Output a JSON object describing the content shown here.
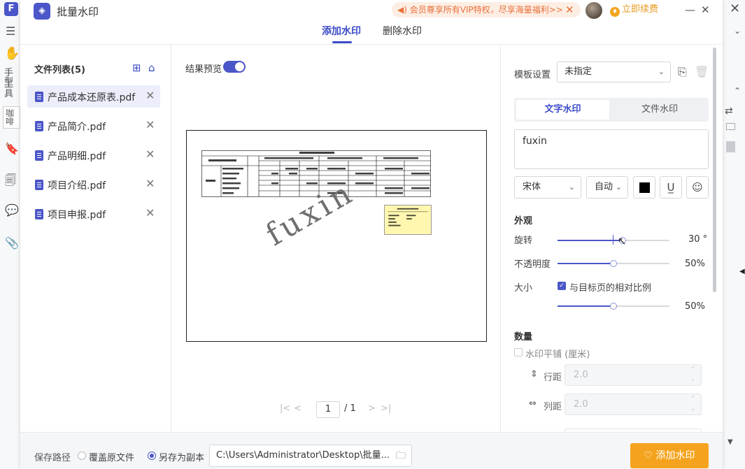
{
  "background_app": {
    "left_icons": [
      "F",
      "☰",
      "✋",
      "🔖",
      "🗐",
      "💬",
      "📎"
    ],
    "left_texts": [
      "手型",
      "工具",
      "咖啡"
    ]
  },
  "window": {
    "title": "批量水印",
    "vip_banner": "会员尊享所有VIP特权，尽享海量福利>>",
    "renew": "立即续费",
    "minimize": "—",
    "close": "✕"
  },
  "tabs": {
    "add": "添加水印",
    "remove": "删除水印"
  },
  "file_list": {
    "title": "文件列表(5)",
    "files": [
      "产品成本还原表.pdf",
      "产品简介.pdf",
      "产品明细.pdf",
      "项目介绍.pdf",
      "项目申报.pdf"
    ]
  },
  "preview": {
    "label": "结果预览",
    "watermark_text": "fuxin",
    "page_current": "1",
    "page_total": "/ 1"
  },
  "settings": {
    "template_label": "模板设置",
    "template_value": "未指定",
    "type_text": "文字水印",
    "type_file": "文件水印",
    "watermark_input": "fuxin",
    "font": "宋体",
    "size": "自动",
    "appearance_title": "外观",
    "rotation_label": "旋转",
    "rotation_value": "30 °",
    "rotation_fraction": 0.58,
    "opacity_label": "不透明度",
    "opacity_value": "50%",
    "opacity_fraction": 0.5,
    "scale_label": "大小",
    "scale_checkbox": "与目标页的相对比例",
    "scale_value": "50%",
    "scale_fraction": 0.5,
    "quantity_title": "数量",
    "tile_label": "水印平铺 (厘米)",
    "row_spacing_label": "行距",
    "row_spacing_value": "2.0",
    "col_spacing_label": "列距",
    "col_spacing_value": "2.0"
  },
  "footer": {
    "save_path_label": "保存路径",
    "overwrite": "覆盖原文件",
    "save_copy": "另存为副本",
    "path": "C:\\Users\\Administrator\\Desktop\\批量...",
    "add_button": "添加水印"
  },
  "colors": {
    "accent": "#4b56c8",
    "orange": "#f5a31e"
  }
}
